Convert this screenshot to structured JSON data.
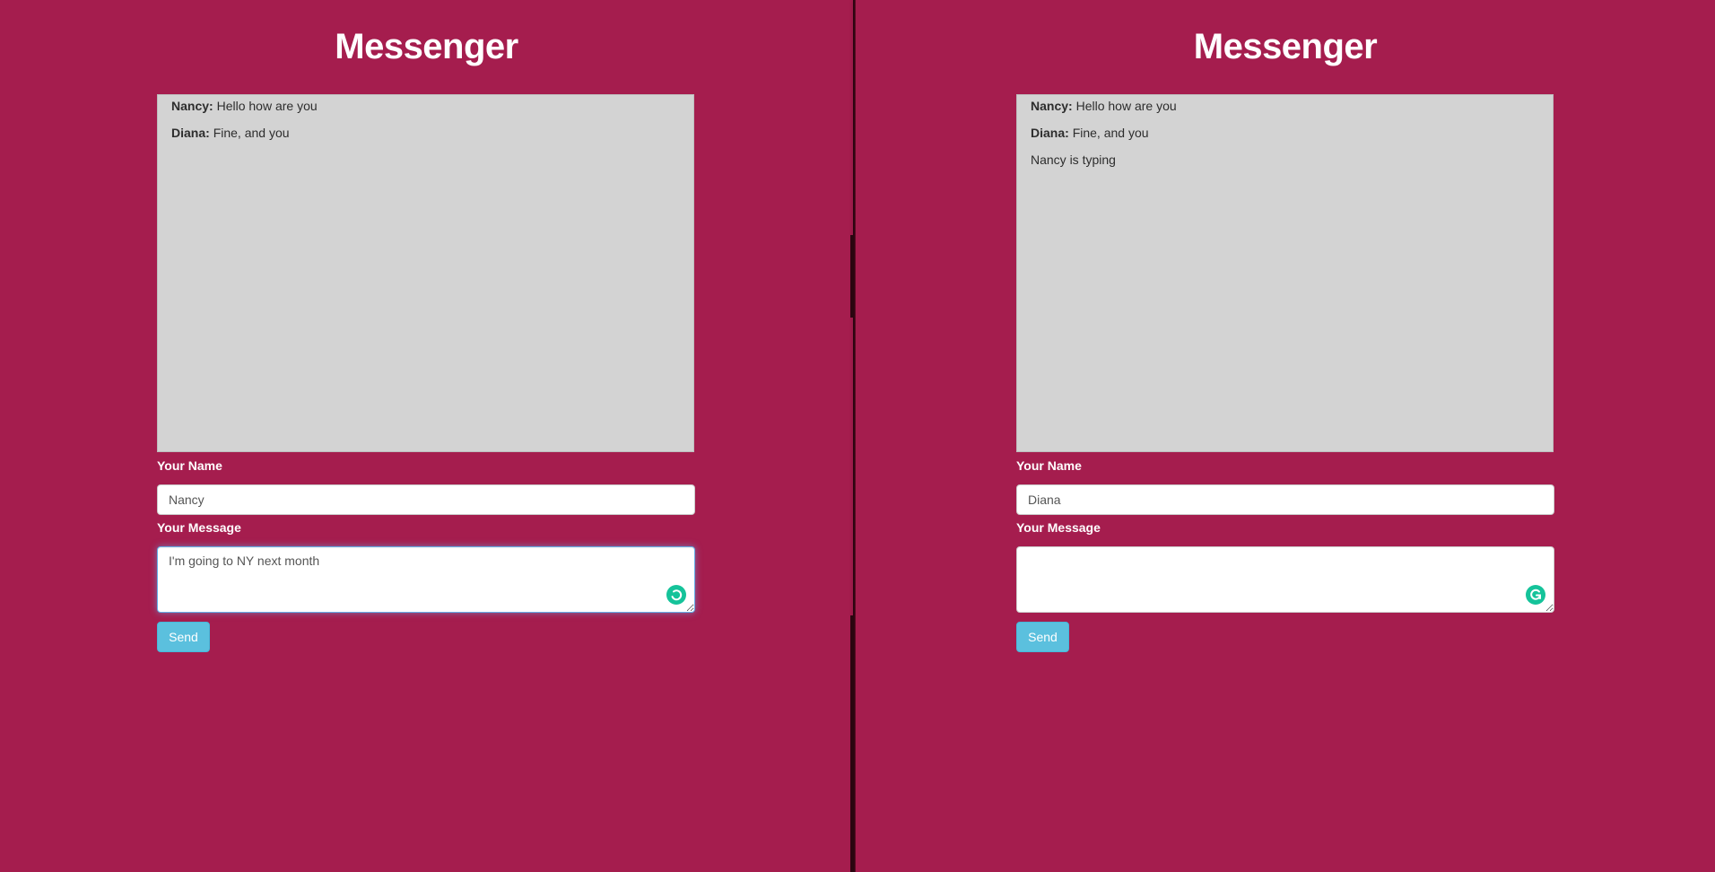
{
  "colors": {
    "page_background": "#a51d4e",
    "chat_log_background": "#d3d3d3",
    "send_button": "#5bc0de",
    "grammarly_badge": "#15c39a"
  },
  "left": {
    "title": "Messenger",
    "messages": [
      {
        "author": "Nancy:",
        "text": "Hello how are you"
      },
      {
        "author": "Diana:",
        "text": "Fine, and you"
      }
    ],
    "name_label": "Your Name",
    "name_value": "Nancy",
    "message_label": "Your Message",
    "message_value": "I'm going to NY next month",
    "send_label": "Send",
    "badge_icon": "grammarly-loading-icon"
  },
  "right": {
    "title": "Messenger",
    "messages": [
      {
        "author": "Nancy:",
        "text": "Hello how are you"
      },
      {
        "author": "Diana:",
        "text": "Fine, and you"
      }
    ],
    "typing_indicator": "Nancy is typing",
    "name_label": "Your Name",
    "name_value": "Diana",
    "message_label": "Your Message",
    "message_value": "",
    "send_label": "Send",
    "badge_icon": "grammarly-g-icon"
  }
}
